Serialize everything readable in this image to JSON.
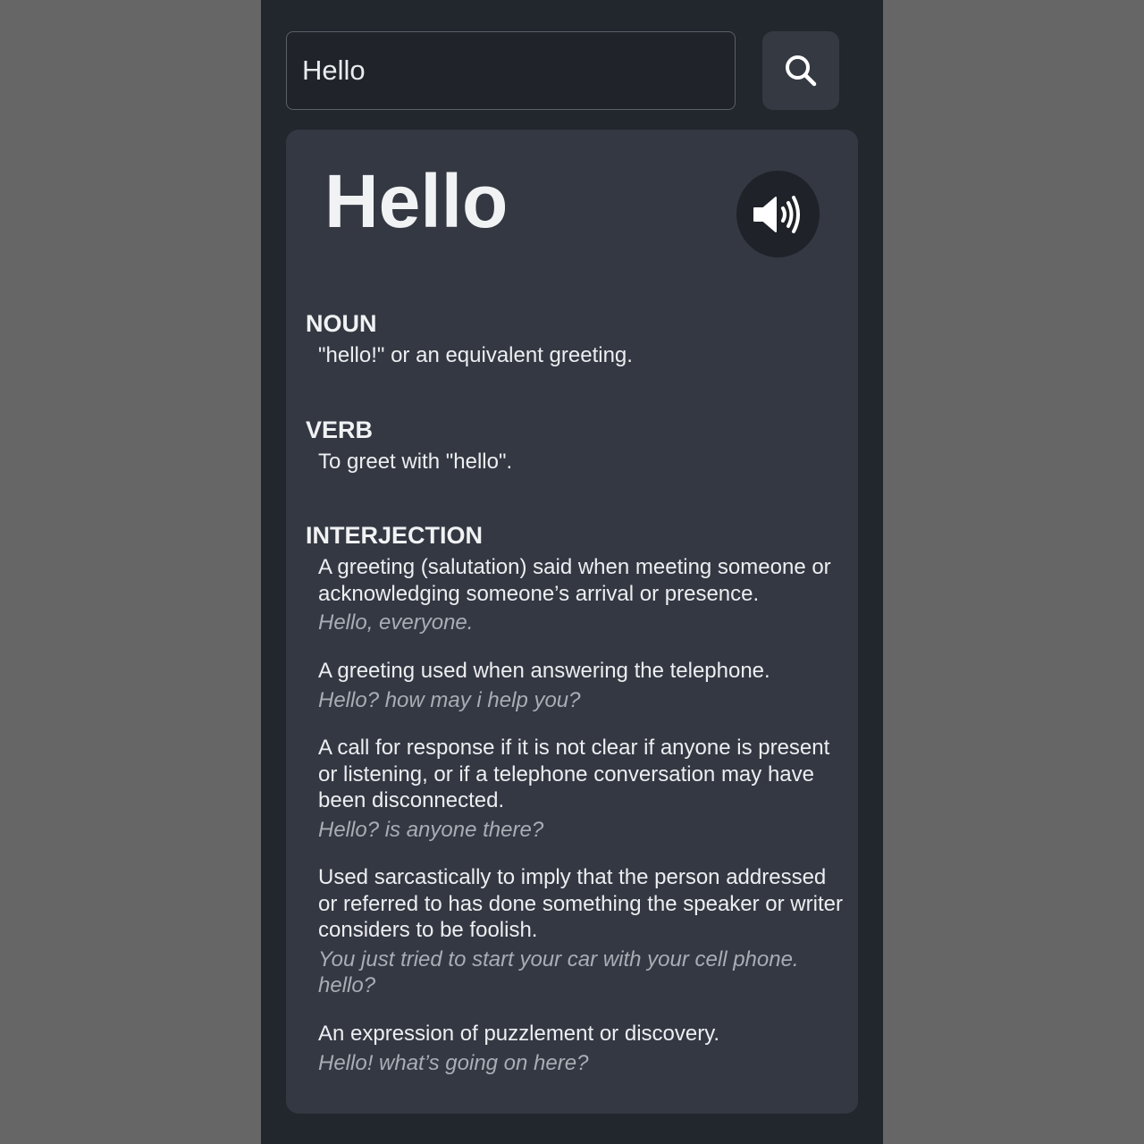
{
  "search": {
    "value": "Hello",
    "icon": "search-icon"
  },
  "entry": {
    "word": "Hello",
    "audio_icon": "speaker-icon",
    "sections": [
      {
        "pos": "NOUN",
        "definitions": [
          {
            "text": "\"hello!\" or an equivalent greeting.",
            "example": ""
          }
        ]
      },
      {
        "pos": "VERB",
        "definitions": [
          {
            "text": "To greet with \"hello\".",
            "example": ""
          }
        ]
      },
      {
        "pos": "INTERJECTION",
        "definitions": [
          {
            "text": "A greeting (salutation) said when meeting someone or acknowledging someone’s arrival or presence.",
            "example": "Hello, everyone."
          },
          {
            "text": "A greeting used when answering the telephone.",
            "example": "Hello? how may i help you?"
          },
          {
            "text": "A call for response if it is not clear if anyone is present or listening, or if a telephone conversation may have been disconnected.",
            "example": "Hello? is anyone there?"
          },
          {
            "text": "Used sarcastically to imply that the person addressed or referred to has done something the speaker or writer considers to be foolish.",
            "example": "You just tried to start your car with your cell phone. hello?"
          },
          {
            "text": "An expression of puzzlement or discovery.",
            "example": "Hello! what’s going on here?"
          }
        ]
      }
    ]
  },
  "colors": {
    "background": "#666666",
    "app_background": "#22262d",
    "card": "#343842",
    "text": "#eceef1",
    "example_text": "#a9adb4"
  }
}
